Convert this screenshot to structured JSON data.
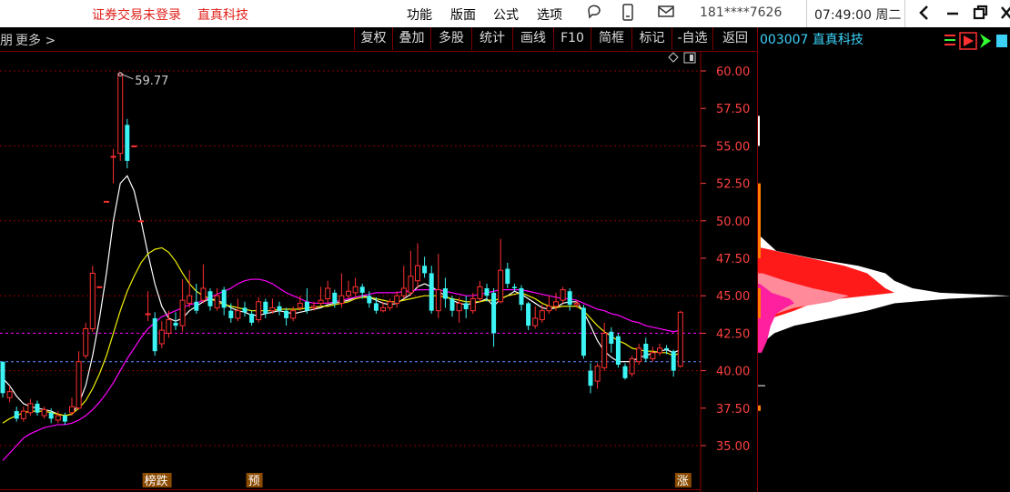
{
  "titlebar": {
    "trade_status": "证券交易未登录",
    "stock_name": "直真科技",
    "menu": [
      "功能",
      "版面",
      "公式",
      "选项"
    ],
    "phone": "181****7626",
    "clock": "07:49:00 周二"
  },
  "toolbar": {
    "left_partial": "朋",
    "more": "更多",
    "buttons": [
      "复权",
      "叠加",
      "多股",
      "统计",
      "画线",
      "F10",
      "简框",
      "标记",
      "-自选",
      "返回"
    ]
  },
  "right_panel": {
    "stock_label": "003007 直真科技"
  },
  "colors": {
    "up": "#ff3030",
    "down": "#3cf4f4",
    "ma1": "#ffffff",
    "ma2": "#f0f000",
    "ma3": "#ff00ff",
    "grid": "#8b0000",
    "axis_text": "#ff4040"
  },
  "chart_data": {
    "type": "candlestick",
    "y_ticks": [
      "60.00",
      "57.50",
      "55.00",
      "52.50",
      "50.00",
      "47.50",
      "45.00",
      "42.50",
      "40.00",
      "37.50",
      "35.00"
    ],
    "ylim": [
      32.0,
      60.5
    ],
    "dashed_levels": [
      {
        "value": 42.5,
        "color": "#ff00ff"
      },
      {
        "value": 40.6,
        "color": "#5a8cff"
      }
    ],
    "annotation": {
      "text": "59.77",
      "value": 59.77,
      "index": 17
    },
    "markers": [
      {
        "text": "榜跌",
        "index": 21
      },
      {
        "text": "预",
        "index": 36
      },
      {
        "text": "涨",
        "index": 98
      }
    ],
    "candles": [
      [
        40.6,
        38.5,
        40.6,
        38.2
      ],
      [
        38.2,
        38.6,
        39.0,
        37.9
      ],
      [
        37.3,
        36.8,
        37.6,
        36.6
      ],
      [
        36.8,
        37.3,
        37.6,
        36.6
      ],
      [
        37.2,
        37.8,
        38.1,
        37.0
      ],
      [
        37.8,
        37.2,
        38.0,
        37.0
      ],
      [
        37.0,
        37.4,
        37.6,
        36.8
      ],
      [
        37.2,
        36.8,
        37.5,
        36.5
      ],
      [
        36.7,
        37.0,
        37.3,
        36.5
      ],
      [
        37.0,
        36.6,
        37.2,
        36.4
      ],
      [
        37.2,
        37.6,
        38.2,
        37.0
      ],
      [
        37.5,
        40.6,
        41.3,
        37.4
      ],
      [
        41.0,
        42.8,
        43.2,
        40.8
      ],
      [
        42.8,
        46.5,
        47.0,
        42.6
      ],
      [
        45.6,
        45.6,
        45.6,
        45.6
      ],
      [
        51.3,
        51.3,
        51.3,
        51.3
      ],
      [
        54.3,
        54.3,
        54.8,
        52.5
      ],
      [
        54.5,
        59.8,
        59.8,
        54.0
      ],
      [
        56.4,
        54.0,
        56.8,
        53.5
      ],
      [
        55.0,
        55.0,
        55.0,
        55.0
      ],
      [
        50.0,
        50.0,
        50.0,
        50.0
      ],
      [
        43.8,
        43.8,
        45.3,
        43.3
      ],
      [
        43.5,
        41.3,
        43.9,
        41.0
      ],
      [
        41.8,
        42.7,
        43.3,
        41.5
      ],
      [
        42.5,
        43.4,
        44.0,
        42.2
      ],
      [
        43.2,
        43.0,
        43.9,
        42.7
      ],
      [
        43.0,
        44.7,
        46.1,
        42.6
      ],
      [
        44.5,
        45.0,
        46.7,
        44.2
      ],
      [
        44.6,
        44.0,
        45.8,
        43.8
      ],
      [
        44.7,
        45.5,
        47.1,
        44.5
      ],
      [
        45.3,
        44.3,
        45.5,
        44.0
      ],
      [
        44.2,
        45.0,
        45.5,
        44.0
      ],
      [
        45.4,
        44.2,
        45.6,
        43.7
      ],
      [
        44.0,
        43.5,
        44.5,
        43.2
      ],
      [
        43.5,
        44.0,
        44.8,
        43.3
      ],
      [
        44.2,
        43.9,
        44.6,
        43.6
      ],
      [
        43.8,
        43.2,
        44.0,
        43.0
      ],
      [
        43.4,
        44.6,
        44.9,
        43.2
      ],
      [
        44.6,
        43.8,
        44.8,
        43.5
      ],
      [
        44.0,
        44.2,
        44.8,
        43.8
      ],
      [
        44.3,
        44.0,
        44.6,
        43.7
      ],
      [
        44.0,
        43.5,
        44.2,
        43.0
      ],
      [
        43.5,
        44.0,
        44.3,
        43.3
      ],
      [
        44.2,
        44.5,
        45.0,
        44.0
      ],
      [
        44.6,
        44.0,
        45.5,
        43.8
      ],
      [
        44.2,
        44.3,
        44.6,
        44.0
      ],
      [
        44.5,
        44.7,
        45.6,
        44.3
      ],
      [
        44.8,
        45.5,
        46.0,
        44.5
      ],
      [
        45.2,
        44.5,
        45.4,
        44.2
      ],
      [
        44.5,
        45.0,
        46.5,
        44.2
      ],
      [
        45.0,
        45.3,
        46.0,
        44.8
      ],
      [
        45.2,
        45.6,
        46.2,
        45.0
      ],
      [
        45.6,
        45.2,
        45.8,
        44.8
      ],
      [
        45.0,
        44.5,
        45.3,
        44.2
      ],
      [
        44.5,
        44.0,
        44.9,
        43.8
      ],
      [
        44.0,
        44.2,
        44.6,
        43.9
      ],
      [
        44.2,
        44.6,
        44.8,
        44.0
      ],
      [
        44.5,
        45.0,
        45.3,
        44.2
      ],
      [
        45.0,
        45.5,
        47.0,
        44.8
      ],
      [
        45.2,
        46.3,
        48.0,
        45.0
      ],
      [
        46.0,
        47.0,
        48.5,
        45.5
      ],
      [
        47.0,
        46.5,
        47.6,
        46.2
      ],
      [
        46.5,
        44.0,
        47.0,
        43.8
      ],
      [
        44.0,
        45.4,
        47.8,
        43.5
      ],
      [
        45.5,
        44.8,
        46.2,
        44.2
      ],
      [
        44.8,
        44.0,
        45.0,
        43.6
      ],
      [
        44.0,
        44.5,
        44.9,
        43.2
      ],
      [
        44.5,
        44.1,
        45.0,
        43.5
      ],
      [
        44.0,
        44.8,
        45.2,
        43.8
      ],
      [
        44.8,
        45.6,
        46.0,
        44.6
      ],
      [
        45.5,
        45.0,
        45.8,
        44.6
      ],
      [
        45.2,
        42.5,
        45.5,
        41.6
      ],
      [
        44.6,
        46.7,
        48.8,
        44.5
      ],
      [
        46.8,
        45.8,
        47.2,
        45.5
      ],
      [
        45.6,
        45.5,
        45.8,
        45.3
      ],
      [
        45.5,
        44.4,
        45.7,
        44.0
      ],
      [
        44.5,
        43.0,
        44.6,
        42.7
      ],
      [
        43.0,
        43.5,
        44.3,
        42.8
      ],
      [
        43.4,
        44.0,
        44.4,
        43.2
      ],
      [
        44.0,
        44.3,
        45.0,
        43.8
      ],
      [
        44.3,
        44.6,
        45.2,
        44.0
      ],
      [
        44.7,
        45.4,
        45.6,
        44.5
      ],
      [
        45.3,
        44.4,
        45.5,
        44.0
      ],
      [
        44.4,
        44.5,
        44.7,
        44.2
      ],
      [
        44.2,
        41.0,
        44.4,
        40.8
      ],
      [
        40.0,
        39.0,
        40.5,
        38.5
      ],
      [
        39.3,
        40.3,
        40.5,
        38.8
      ],
      [
        40.2,
        42.5,
        43.2,
        40.0
      ],
      [
        42.6,
        41.8,
        42.9,
        41.2
      ],
      [
        42.3,
        40.4,
        42.5,
        40.2
      ],
      [
        40.3,
        39.5,
        40.5,
        39.4
      ],
      [
        39.8,
        40.8,
        41.0,
        39.6
      ],
      [
        40.6,
        41.5,
        41.8,
        40.4
      ],
      [
        41.8,
        40.8,
        42.2,
        40.6
      ],
      [
        40.8,
        41.2,
        41.6,
        40.6
      ],
      [
        41.2,
        41.5,
        41.8,
        41.0
      ],
      [
        41.5,
        41.4,
        41.7,
        41.1
      ],
      [
        41.3,
        40.0,
        41.4,
        39.6
      ],
      [
        40.3,
        43.9,
        44.0,
        40.2
      ]
    ],
    "ma_white": [
      39.5,
      39.0,
      38.3,
      37.8,
      37.6,
      37.5,
      37.4,
      37.3,
      37.1,
      37.0,
      37.1,
      37.8,
      39.0,
      41.0,
      43.5,
      46.5,
      50.0,
      52.5,
      53.0,
      52.0,
      50.0,
      47.8,
      45.8,
      44.3,
      43.5,
      43.3,
      43.5,
      44.0,
      44.3,
      44.6,
      44.8,
      44.7,
      44.5,
      44.2,
      44.0,
      43.9,
      43.7,
      43.7,
      43.8,
      43.9,
      44.0,
      43.9,
      43.8,
      43.9,
      44.0,
      44.1,
      44.2,
      44.4,
      44.5,
      44.6,
      44.7,
      44.9,
      45.0,
      44.9,
      44.7,
      44.5,
      44.4,
      44.5,
      44.8,
      45.1,
      45.6,
      45.8,
      45.6,
      45.3,
      45.0,
      44.7,
      44.5,
      44.4,
      44.5,
      44.6,
      44.8,
      44.3,
      44.8,
      45.0,
      45.3,
      45.1,
      44.8,
      44.5,
      44.2,
      44.1,
      44.2,
      44.5,
      44.6,
      44.6,
      43.9,
      43.0,
      42.0,
      41.3,
      40.9,
      40.6,
      40.6,
      40.6,
      40.9,
      41.0,
      41.2,
      41.3,
      41.4,
      41.2,
      41.4
    ],
    "ma_yellow": [
      36.5,
      36.8,
      37.0,
      37.2,
      37.3,
      37.3,
      37.3,
      37.2,
      37.1,
      37.0,
      37.1,
      37.5,
      38.0,
      38.8,
      39.8,
      41.0,
      42.5,
      44.0,
      45.3,
      46.3,
      47.2,
      47.8,
      48.1,
      48.2,
      47.9,
      47.3,
      46.5,
      45.8,
      45.3,
      45.0,
      44.8,
      44.6,
      44.4,
      44.3,
      44.2,
      44.1,
      44.0,
      44.0,
      44.0,
      44.0,
      44.1,
      44.1,
      44.1,
      44.1,
      44.2,
      44.2,
      44.3,
      44.3,
      44.4,
      44.5,
      44.6,
      44.8,
      44.9,
      44.9,
      44.8,
      44.7,
      44.6,
      44.6,
      44.7,
      44.8,
      44.9,
      45.0,
      45.0,
      45.0,
      44.9,
      44.8,
      44.7,
      44.6,
      44.6,
      44.6,
      44.7,
      44.7,
      44.8,
      45.0,
      45.1,
      45.2,
      45.0,
      44.8,
      44.5,
      44.3,
      44.2,
      44.3,
      44.3,
      44.3,
      44.0,
      43.5,
      43.0,
      42.6,
      42.3,
      42.0,
      41.8,
      41.5,
      41.4,
      41.3,
      41.3,
      41.2,
      41.2,
      41.0,
      41.2
    ],
    "ma_magenta": [
      34.0,
      34.5,
      35.0,
      35.5,
      35.8,
      36.0,
      36.2,
      36.3,
      36.4,
      36.4,
      36.5,
      36.7,
      37.0,
      37.4,
      37.9,
      38.5,
      39.2,
      40.0,
      40.8,
      41.5,
      42.2,
      42.8,
      43.2,
      43.6,
      43.8,
      44.0,
      44.2,
      44.4,
      44.5,
      44.7,
      44.9,
      45.1,
      45.3,
      45.5,
      45.8,
      46.0,
      46.1,
      46.1,
      46.0,
      45.8,
      45.5,
      45.2,
      45.0,
      44.8,
      44.6,
      44.5,
      44.5,
      44.5,
      44.6,
      44.7,
      44.8,
      44.9,
      45.0,
      45.1,
      45.2,
      45.2,
      45.2,
      45.2,
      45.3,
      45.3,
      45.4,
      45.4,
      45.4,
      45.4,
      45.3,
      45.2,
      45.1,
      45.0,
      45.0,
      45.1,
      45.2,
      45.3,
      45.4,
      45.4,
      45.4,
      45.4,
      45.3,
      45.2,
      45.1,
      45.0,
      44.9,
      44.8,
      44.8,
      44.7,
      44.5,
      44.3,
      44.1,
      44.0,
      43.8,
      43.7,
      43.5,
      43.3,
      43.2,
      43.0,
      42.9,
      42.8,
      42.7,
      42.6,
      42.7
    ]
  }
}
